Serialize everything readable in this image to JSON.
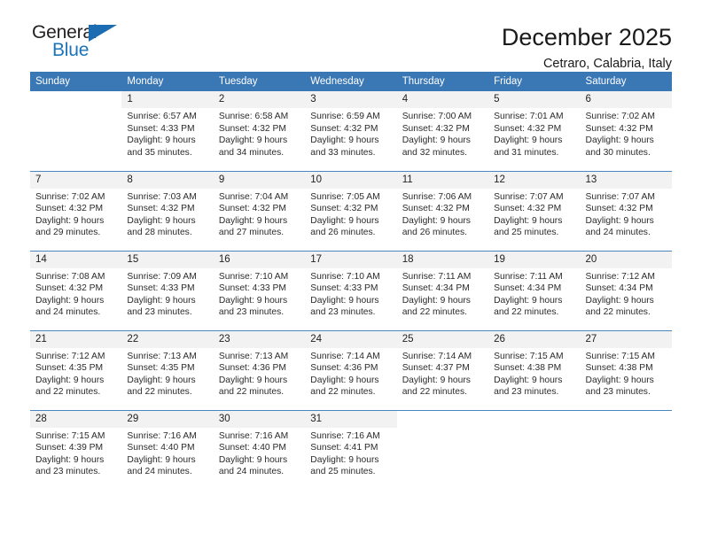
{
  "logo": {
    "word_one": "General",
    "word_two": "Blue",
    "triangle_color": "#1b6cb0",
    "blue_color": "#1b75bb"
  },
  "header": {
    "title": "December 2025",
    "subtitle": "Cetraro, Calabria, Italy"
  },
  "theme": {
    "header_row_bg": "#3a77b5",
    "header_row_text": "#ffffff",
    "daynum_band_bg": "#f2f2f2",
    "row_divider": "#4a86c0",
    "cell_bg": "#ffffff",
    "body_text": "#2b2b2b"
  },
  "calendar": {
    "weekday_headers": [
      "Sunday",
      "Monday",
      "Tuesday",
      "Wednesday",
      "Thursday",
      "Friday",
      "Saturday"
    ],
    "weeks": [
      [
        {
          "day": "",
          "sunrise": "",
          "sunset": "",
          "daylight_line1": "",
          "daylight_line2": ""
        },
        {
          "day": "1",
          "sunrise": "Sunrise: 6:57 AM",
          "sunset": "Sunset: 4:33 PM",
          "daylight_line1": "Daylight: 9 hours",
          "daylight_line2": "and 35 minutes."
        },
        {
          "day": "2",
          "sunrise": "Sunrise: 6:58 AM",
          "sunset": "Sunset: 4:32 PM",
          "daylight_line1": "Daylight: 9 hours",
          "daylight_line2": "and 34 minutes."
        },
        {
          "day": "3",
          "sunrise": "Sunrise: 6:59 AM",
          "sunset": "Sunset: 4:32 PM",
          "daylight_line1": "Daylight: 9 hours",
          "daylight_line2": "and 33 minutes."
        },
        {
          "day": "4",
          "sunrise": "Sunrise: 7:00 AM",
          "sunset": "Sunset: 4:32 PM",
          "daylight_line1": "Daylight: 9 hours",
          "daylight_line2": "and 32 minutes."
        },
        {
          "day": "5",
          "sunrise": "Sunrise: 7:01 AM",
          "sunset": "Sunset: 4:32 PM",
          "daylight_line1": "Daylight: 9 hours",
          "daylight_line2": "and 31 minutes."
        },
        {
          "day": "6",
          "sunrise": "Sunrise: 7:02 AM",
          "sunset": "Sunset: 4:32 PM",
          "daylight_line1": "Daylight: 9 hours",
          "daylight_line2": "and 30 minutes."
        }
      ],
      [
        {
          "day": "7",
          "sunrise": "Sunrise: 7:02 AM",
          "sunset": "Sunset: 4:32 PM",
          "daylight_line1": "Daylight: 9 hours",
          "daylight_line2": "and 29 minutes."
        },
        {
          "day": "8",
          "sunrise": "Sunrise: 7:03 AM",
          "sunset": "Sunset: 4:32 PM",
          "daylight_line1": "Daylight: 9 hours",
          "daylight_line2": "and 28 minutes."
        },
        {
          "day": "9",
          "sunrise": "Sunrise: 7:04 AM",
          "sunset": "Sunset: 4:32 PM",
          "daylight_line1": "Daylight: 9 hours",
          "daylight_line2": "and 27 minutes."
        },
        {
          "day": "10",
          "sunrise": "Sunrise: 7:05 AM",
          "sunset": "Sunset: 4:32 PM",
          "daylight_line1": "Daylight: 9 hours",
          "daylight_line2": "and 26 minutes."
        },
        {
          "day": "11",
          "sunrise": "Sunrise: 7:06 AM",
          "sunset": "Sunset: 4:32 PM",
          "daylight_line1": "Daylight: 9 hours",
          "daylight_line2": "and 26 minutes."
        },
        {
          "day": "12",
          "sunrise": "Sunrise: 7:07 AM",
          "sunset": "Sunset: 4:32 PM",
          "daylight_line1": "Daylight: 9 hours",
          "daylight_line2": "and 25 minutes."
        },
        {
          "day": "13",
          "sunrise": "Sunrise: 7:07 AM",
          "sunset": "Sunset: 4:32 PM",
          "daylight_line1": "Daylight: 9 hours",
          "daylight_line2": "and 24 minutes."
        }
      ],
      [
        {
          "day": "14",
          "sunrise": "Sunrise: 7:08 AM",
          "sunset": "Sunset: 4:32 PM",
          "daylight_line1": "Daylight: 9 hours",
          "daylight_line2": "and 24 minutes."
        },
        {
          "day": "15",
          "sunrise": "Sunrise: 7:09 AM",
          "sunset": "Sunset: 4:33 PM",
          "daylight_line1": "Daylight: 9 hours",
          "daylight_line2": "and 23 minutes."
        },
        {
          "day": "16",
          "sunrise": "Sunrise: 7:10 AM",
          "sunset": "Sunset: 4:33 PM",
          "daylight_line1": "Daylight: 9 hours",
          "daylight_line2": "and 23 minutes."
        },
        {
          "day": "17",
          "sunrise": "Sunrise: 7:10 AM",
          "sunset": "Sunset: 4:33 PM",
          "daylight_line1": "Daylight: 9 hours",
          "daylight_line2": "and 23 minutes."
        },
        {
          "day": "18",
          "sunrise": "Sunrise: 7:11 AM",
          "sunset": "Sunset: 4:34 PM",
          "daylight_line1": "Daylight: 9 hours",
          "daylight_line2": "and 22 minutes."
        },
        {
          "day": "19",
          "sunrise": "Sunrise: 7:11 AM",
          "sunset": "Sunset: 4:34 PM",
          "daylight_line1": "Daylight: 9 hours",
          "daylight_line2": "and 22 minutes."
        },
        {
          "day": "20",
          "sunrise": "Sunrise: 7:12 AM",
          "sunset": "Sunset: 4:34 PM",
          "daylight_line1": "Daylight: 9 hours",
          "daylight_line2": "and 22 minutes."
        }
      ],
      [
        {
          "day": "21",
          "sunrise": "Sunrise: 7:12 AM",
          "sunset": "Sunset: 4:35 PM",
          "daylight_line1": "Daylight: 9 hours",
          "daylight_line2": "and 22 minutes."
        },
        {
          "day": "22",
          "sunrise": "Sunrise: 7:13 AM",
          "sunset": "Sunset: 4:35 PM",
          "daylight_line1": "Daylight: 9 hours",
          "daylight_line2": "and 22 minutes."
        },
        {
          "day": "23",
          "sunrise": "Sunrise: 7:13 AM",
          "sunset": "Sunset: 4:36 PM",
          "daylight_line1": "Daylight: 9 hours",
          "daylight_line2": "and 22 minutes."
        },
        {
          "day": "24",
          "sunrise": "Sunrise: 7:14 AM",
          "sunset": "Sunset: 4:36 PM",
          "daylight_line1": "Daylight: 9 hours",
          "daylight_line2": "and 22 minutes."
        },
        {
          "day": "25",
          "sunrise": "Sunrise: 7:14 AM",
          "sunset": "Sunset: 4:37 PM",
          "daylight_line1": "Daylight: 9 hours",
          "daylight_line2": "and 22 minutes."
        },
        {
          "day": "26",
          "sunrise": "Sunrise: 7:15 AM",
          "sunset": "Sunset: 4:38 PM",
          "daylight_line1": "Daylight: 9 hours",
          "daylight_line2": "and 23 minutes."
        },
        {
          "day": "27",
          "sunrise": "Sunrise: 7:15 AM",
          "sunset": "Sunset: 4:38 PM",
          "daylight_line1": "Daylight: 9 hours",
          "daylight_line2": "and 23 minutes."
        }
      ],
      [
        {
          "day": "28",
          "sunrise": "Sunrise: 7:15 AM",
          "sunset": "Sunset: 4:39 PM",
          "daylight_line1": "Daylight: 9 hours",
          "daylight_line2": "and 23 minutes."
        },
        {
          "day": "29",
          "sunrise": "Sunrise: 7:16 AM",
          "sunset": "Sunset: 4:40 PM",
          "daylight_line1": "Daylight: 9 hours",
          "daylight_line2": "and 24 minutes."
        },
        {
          "day": "30",
          "sunrise": "Sunrise: 7:16 AM",
          "sunset": "Sunset: 4:40 PM",
          "daylight_line1": "Daylight: 9 hours",
          "daylight_line2": "and 24 minutes."
        },
        {
          "day": "31",
          "sunrise": "Sunrise: 7:16 AM",
          "sunset": "Sunset: 4:41 PM",
          "daylight_line1": "Daylight: 9 hours",
          "daylight_line2": "and 25 minutes."
        },
        {
          "day": "",
          "sunrise": "",
          "sunset": "",
          "daylight_line1": "",
          "daylight_line2": ""
        },
        {
          "day": "",
          "sunrise": "",
          "sunset": "",
          "daylight_line1": "",
          "daylight_line2": ""
        },
        {
          "day": "",
          "sunrise": "",
          "sunset": "",
          "daylight_line1": "",
          "daylight_line2": ""
        }
      ]
    ]
  }
}
